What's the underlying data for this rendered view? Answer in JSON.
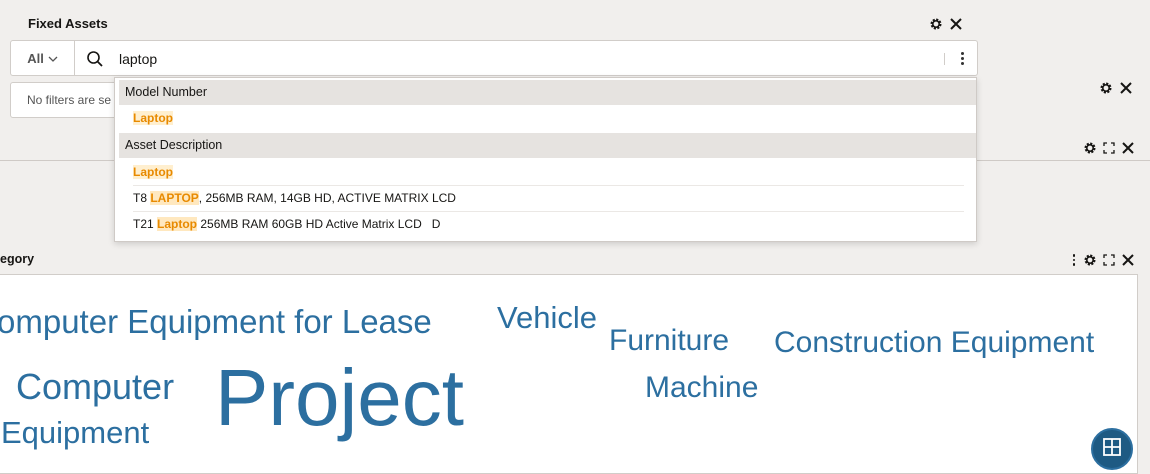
{
  "header": {
    "title": "Fixed Assets"
  },
  "search": {
    "scope_label": "All",
    "query": "laptop"
  },
  "filters": {
    "text": "No filters are se"
  },
  "dropdown": {
    "groups": [
      {
        "label": "Model Number",
        "items": [
          {
            "pre": "",
            "match": "Laptop",
            "post": ""
          }
        ]
      },
      {
        "label": "Asset Description",
        "items": [
          {
            "pre": "",
            "match": "Laptop",
            "post": ""
          },
          {
            "pre": "T8 ",
            "match": "LAPTOP",
            "post": ", 256MB RAM, 14GB HD, ACTIVE MATRIX LCD"
          },
          {
            "pre": "T21 ",
            "match": "Laptop",
            "post": " 256MB RAM 60GB HD Active Matrix LCD   D"
          }
        ]
      }
    ]
  },
  "category": {
    "title": "egory",
    "words": [
      "omputer Equipment for Lease",
      "Vehicle",
      "Furniture",
      "Construction Equipment",
      "Computer",
      "Project",
      "Machine",
      "Equipment"
    ]
  },
  "colors": {
    "accent": "#2c6fa0",
    "highlight": "#e88a00"
  },
  "icons": [
    "gear-icon",
    "close-icon",
    "search-icon",
    "chevron-down-icon",
    "kebab-icon",
    "expand-icon",
    "grid-icon"
  ]
}
